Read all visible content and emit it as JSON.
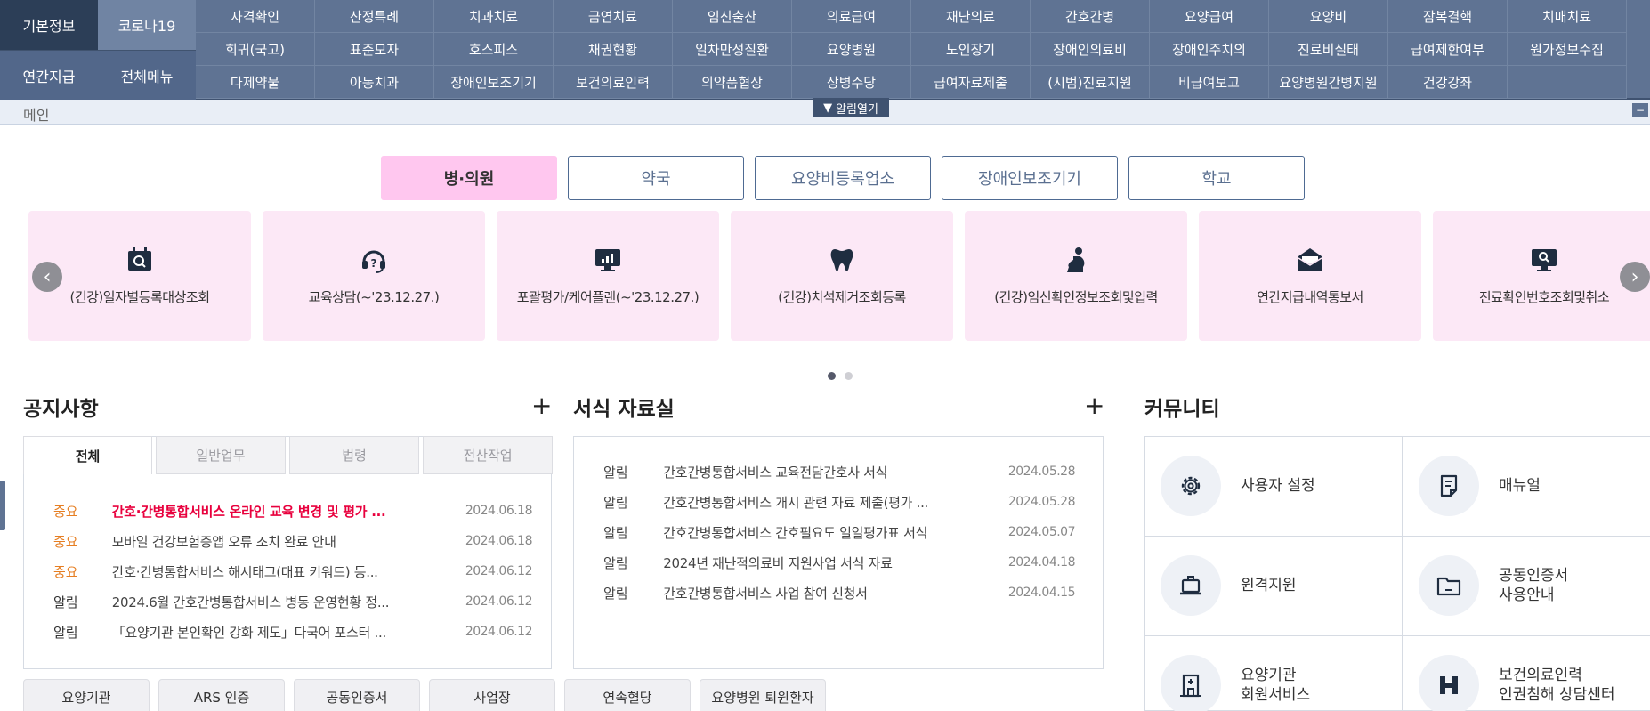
{
  "nav": {
    "left": {
      "basic_info": "기본정보",
      "covid19": "코로나19",
      "annual_payment": "연간지급",
      "all_menu": "전체메뉴"
    },
    "grid": [
      [
        "자격확인",
        "산정특례",
        "치과치료",
        "금연치료",
        "임신출산",
        "의료급여",
        "재난의료",
        "간호간병",
        "요양급여",
        "요양비",
        "잠복결핵",
        "치매치료"
      ],
      [
        "희귀(국고)",
        "표준모자",
        "호스피스",
        "채권현황",
        "일차만성질환",
        "요양병원",
        "노인장기",
        "장애인의료비",
        "장애인주치의",
        "진료비실태",
        "급여제한여부",
        "원가정보수집"
      ],
      [
        "다제약물",
        "아동치과",
        "장애인보조기기",
        "보건의료인력",
        "의약품협상",
        "상병수당",
        "급여자료제출",
        "(시범)진료지원",
        "비급여보고",
        "요양병원간병지원",
        "건강강좌",
        ""
      ]
    ]
  },
  "breadcrumb": "메인",
  "alarm_toggle": "알림열기",
  "alarm_arrow": "▼",
  "minimize": "−",
  "category_tabs": [
    "병·의원",
    "약국",
    "요양비등록업소",
    "장애인보조기기",
    "학교"
  ],
  "carousel": {
    "prev": "‹",
    "next": "›",
    "cards": [
      {
        "label": "(건강)일자별등록대상조회",
        "icon": "calendar-search-icon"
      },
      {
        "label": "교육상담(~'23.12.27.)",
        "icon": "headset-question-icon"
      },
      {
        "label": "포괄평가/케어플랜(~'23.12.27.)",
        "icon": "monitor-chart-icon"
      },
      {
        "label": "(건강)치석제거조회등록",
        "icon": "tooth-icon"
      },
      {
        "label": "(건강)임신확인정보조회및입력",
        "icon": "pregnancy-icon"
      },
      {
        "label": "연간지급내역통보서",
        "icon": "envelope-icon"
      },
      {
        "label": "진료확인번호조회및취소",
        "icon": "monitor-search-icon"
      }
    ]
  },
  "notice": {
    "title": "공지사항",
    "more": "+",
    "tabs": [
      "전체",
      "일반업무",
      "법령",
      "전산작업"
    ],
    "rows": [
      {
        "tag": "중요",
        "title": "간호·간병통합서비스 온라인 교육 변경 및 평가 ...",
        "date": "2024.06.18"
      },
      {
        "tag": "중요",
        "title": "모바일 건강보험증앱 오류 조치 완료 안내",
        "date": "2024.06.18"
      },
      {
        "tag": "중요",
        "title": "간호·간병통합서비스 해시태그(대표 키워드) 등...",
        "date": "2024.06.12"
      },
      {
        "tag": "알림",
        "title": "2024.6월 간호간병통합서비스 병동 운영현황 정...",
        "date": "2024.06.12"
      },
      {
        "tag": "알림",
        "title": "「요양기관 본인확인 강화 제도」다국어 포스터 ...",
        "date": "2024.06.12"
      }
    ]
  },
  "forms": {
    "title": "서식 자료실",
    "more": "+",
    "rows": [
      {
        "tag": "알림",
        "title": "간호간병통합서비스 교육전담간호사 서식",
        "date": "2024.05.28"
      },
      {
        "tag": "알림",
        "title": "간호간병통합서비스 개시 관련 자료 제출(평가 ...",
        "date": "2024.05.28"
      },
      {
        "tag": "알림",
        "title": "간호간병통합서비스 간호필요도 일일평가표 서식",
        "date": "2024.05.07"
      },
      {
        "tag": "알림",
        "title": "2024년 재난적의료비 지원사업 서식 자료",
        "date": "2024.04.18"
      },
      {
        "tag": "알림",
        "title": "간호간병통합서비스 사업 참여 신청서",
        "date": "2024.04.15"
      }
    ]
  },
  "community": {
    "title": "커뮤니티",
    "items": [
      {
        "label": "사용자 설정",
        "icon": "gear-icon"
      },
      {
        "label": "매뉴얼",
        "icon": "manual-icon"
      },
      {
        "label": "원격지원",
        "icon": "laptop-support-icon"
      },
      {
        "label": "공동인증서\n사용안내",
        "icon": "folder-icon"
      },
      {
        "label": "요양기관\n회원서비스",
        "icon": "hospital-icon"
      },
      {
        "label": "보건의료인력\n인권침해 상담센터",
        "icon": "h-logo-icon"
      }
    ]
  },
  "bottom_buttons": [
    "요양기관",
    "ARS 인증",
    "공동인증서",
    "사업장",
    "연속혈당",
    "요양병원 퇴원환자"
  ],
  "colors": {
    "nav_bg": "#5f7393",
    "nav_active": "#2c3e57",
    "tab_active": "#ffc7ef",
    "card_bg": "#fce8f6",
    "important": "#e67e22",
    "hot_title": "#e8003d"
  }
}
